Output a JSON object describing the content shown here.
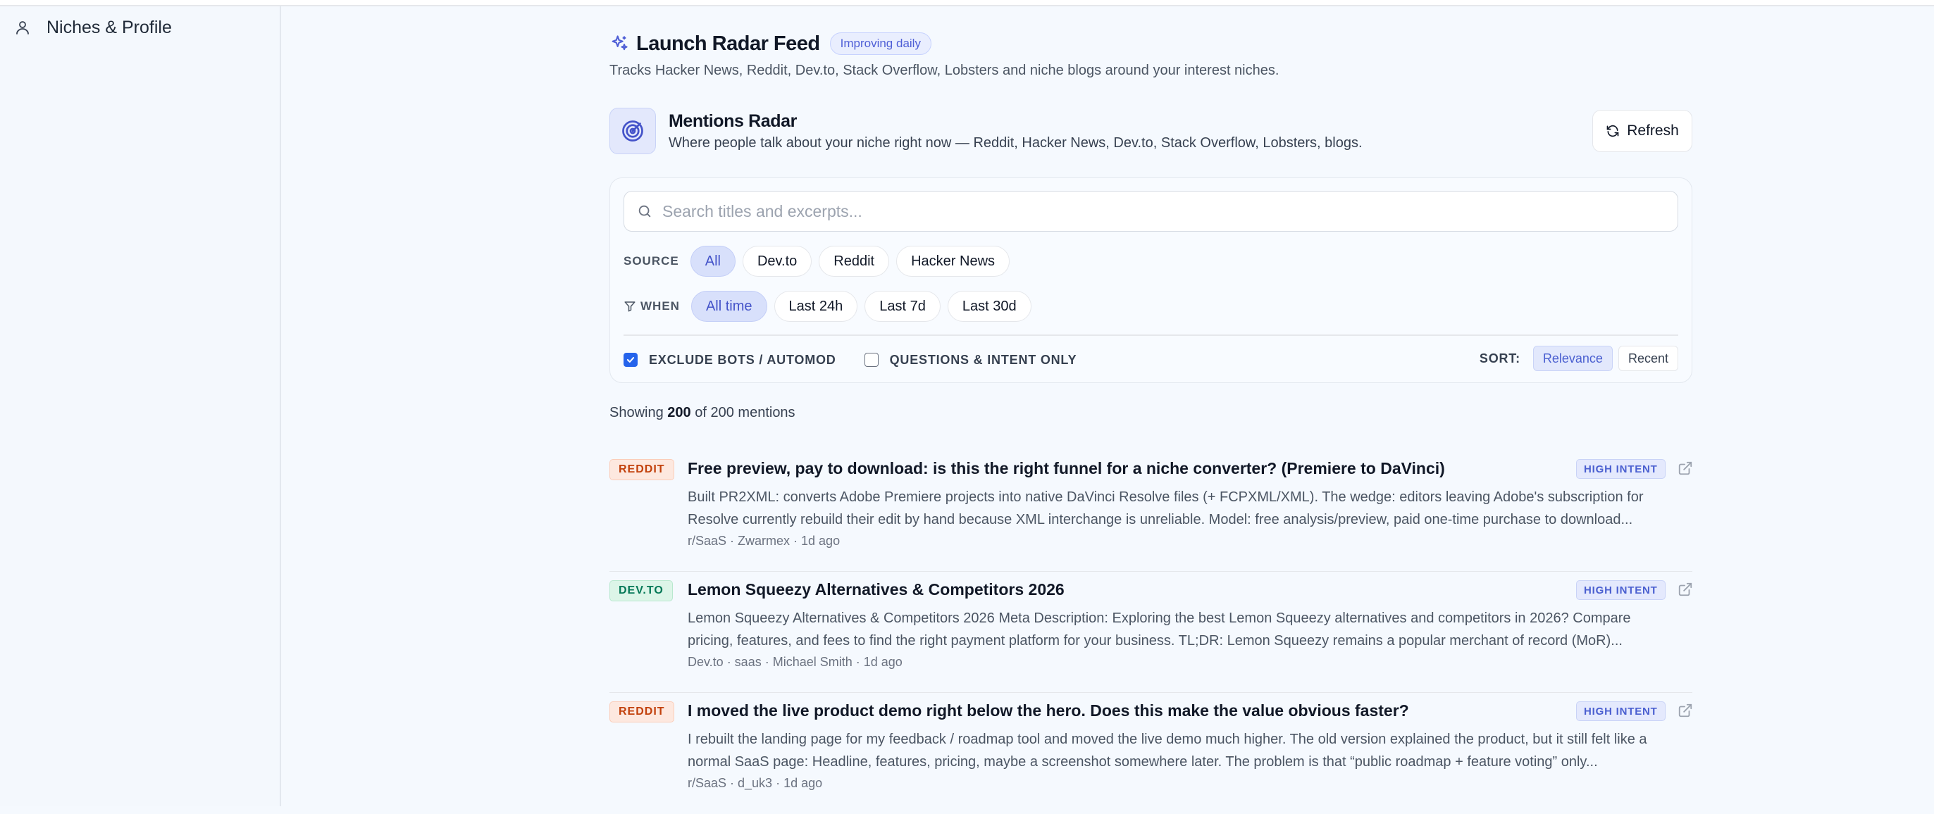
{
  "sidebar": {
    "items": [
      {
        "label": "Niches & Profile",
        "icon": "user-icon"
      }
    ]
  },
  "header": {
    "title": "Launch Radar Feed",
    "badge": "Improving daily",
    "subtitle": "Tracks Hacker News, Reddit, Dev.to, Stack Overflow, Lobsters and niche blogs around your interest niches."
  },
  "radar": {
    "title": "Mentions Radar",
    "description": "Where people talk about your niche right now — Reddit, Hacker News, Dev.to, Stack Overflow, Lobsters, blogs.",
    "refresh_label": "Refresh"
  },
  "filters": {
    "search_placeholder": "Search titles and excerpts...",
    "source_label": "SOURCE",
    "source_options": [
      "All",
      "Dev.to",
      "Reddit",
      "Hacker News"
    ],
    "source_selected": "All",
    "when_label": "WHEN",
    "when_options": [
      "All time",
      "Last 24h",
      "Last 7d",
      "Last 30d"
    ],
    "when_selected": "All time",
    "exclude_bots_label": "EXCLUDE BOTS / AUTOMOD",
    "exclude_bots_checked": true,
    "questions_label": "QUESTIONS & INTENT ONLY",
    "questions_checked": false,
    "sort_label": "SORT:",
    "sort_options": [
      "Relevance",
      "Recent"
    ],
    "sort_selected": "Relevance"
  },
  "results": {
    "prefix": "Showing",
    "shown": "200",
    "middle": "of",
    "total": "200",
    "suffix": "mentions"
  },
  "mentions": [
    {
      "source": "REDDIT",
      "title": "Free preview, pay to download: is this the right funnel for a niche converter? (Premiere to DaVinci)",
      "intent": "HIGH INTENT",
      "excerpt": "Built PR2XML: converts Adobe Premiere projects into native DaVinci Resolve files (+ FCPXML/XML). The wedge: editors leaving Adobe's subscription for Resolve currently rebuild their edit by hand because XML interchange is unreliable. Model: free analysis/preview, paid one-time purchase to download...",
      "meta": "r/SaaS · Zwarmex · 1d ago"
    },
    {
      "source": "DEV.TO",
      "title": "Lemon Squeezy Alternatives & Competitors 2026",
      "intent": "HIGH INTENT",
      "excerpt": "Lemon Squeezy Alternatives & Competitors 2026 Meta Description: Exploring the best Lemon Squeezy alternatives and competitors in 2026? Compare pricing, features, and fees to find the right payment platform for your business. TL;DR: Lemon Squeezy remains a popular merchant of record (MoR)...",
      "meta": "Dev.to · saas · Michael Smith · 1d ago"
    },
    {
      "source": "REDDIT",
      "title": "I moved the live product demo right below the hero. Does this make the value obvious faster?",
      "intent": "HIGH INTENT",
      "excerpt": "I rebuilt the landing page for my feedback / roadmap tool and moved the live demo much higher. The old version explained the product, but it still felt like a normal SaaS page: Headline, features, pricing, maybe a screenshot somewhere later. The problem is that “public roadmap + feature voting” only...",
      "meta": "r/SaaS · d_uk3 · 1d ago"
    }
  ]
}
